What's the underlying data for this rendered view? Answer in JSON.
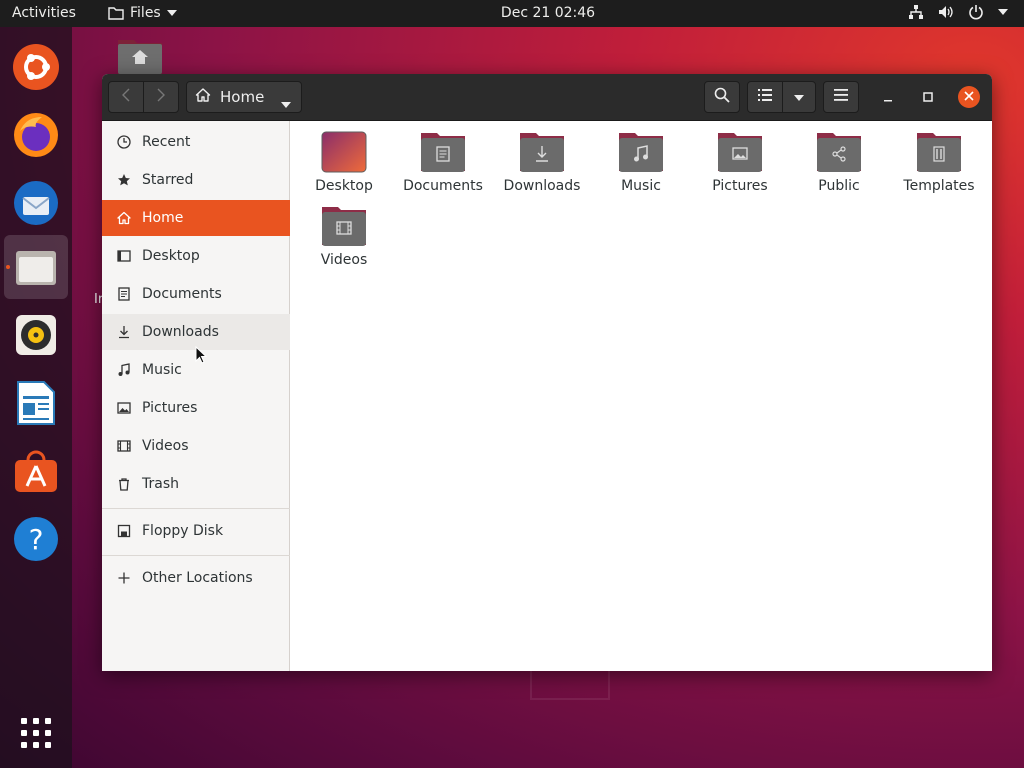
{
  "topbar": {
    "activities": "Activities",
    "app_menu": "Files",
    "clock": "Dec 21  02:46",
    "status_icons": [
      "network-icon",
      "volume-icon",
      "power-icon",
      "chevron-down-icon"
    ]
  },
  "dock": {
    "items": [
      {
        "name": "ubuntu-installer-icon"
      },
      {
        "name": "firefox-icon"
      },
      {
        "name": "thunderbird-icon"
      },
      {
        "name": "files-icon",
        "active": true
      },
      {
        "name": "rhythmbox-icon"
      },
      {
        "name": "libreoffice-writer-icon"
      },
      {
        "name": "ubuntu-software-icon"
      },
      {
        "name": "help-icon"
      }
    ],
    "apps_grid": "show-applications-icon"
  },
  "desktop": {
    "home_icon": "home-folder-icon",
    "partial_label": "Ir"
  },
  "window": {
    "path_label": "Home",
    "sidebar": {
      "items": [
        {
          "label": "Recent",
          "icon": "clock-icon"
        },
        {
          "label": "Starred",
          "icon": "star-icon"
        },
        {
          "label": "Home",
          "icon": "home-icon",
          "selected": true
        },
        {
          "label": "Desktop",
          "icon": "desktop-icon"
        },
        {
          "label": "Documents",
          "icon": "document-icon"
        },
        {
          "label": "Downloads",
          "icon": "download-icon",
          "hover": true
        },
        {
          "label": "Music",
          "icon": "music-icon"
        },
        {
          "label": "Pictures",
          "icon": "picture-icon"
        },
        {
          "label": "Videos",
          "icon": "video-icon"
        },
        {
          "label": "Trash",
          "icon": "trash-icon"
        }
      ],
      "devices": [
        {
          "label": "Floppy Disk",
          "icon": "floppy-icon"
        }
      ],
      "other": [
        {
          "label": "Other Locations",
          "icon": "plus-icon"
        }
      ]
    },
    "files": [
      {
        "label": "Desktop",
        "icon": "desktop-folder-icon"
      },
      {
        "label": "Documents",
        "icon": "documents-folder-icon"
      },
      {
        "label": "Downloads",
        "icon": "downloads-folder-icon"
      },
      {
        "label": "Music",
        "icon": "music-folder-icon"
      },
      {
        "label": "Pictures",
        "icon": "pictures-folder-icon"
      },
      {
        "label": "Public",
        "icon": "public-folder-icon"
      },
      {
        "label": "Templates",
        "icon": "templates-folder-icon"
      },
      {
        "label": "Videos",
        "icon": "videos-folder-icon"
      }
    ]
  },
  "colors": {
    "accent": "#e95420",
    "headerbar": "#2b2b2b",
    "sidebar": "#f6f5f4",
    "folder_body": "#6b6b6b",
    "folder_tab": "#8e2d47"
  }
}
